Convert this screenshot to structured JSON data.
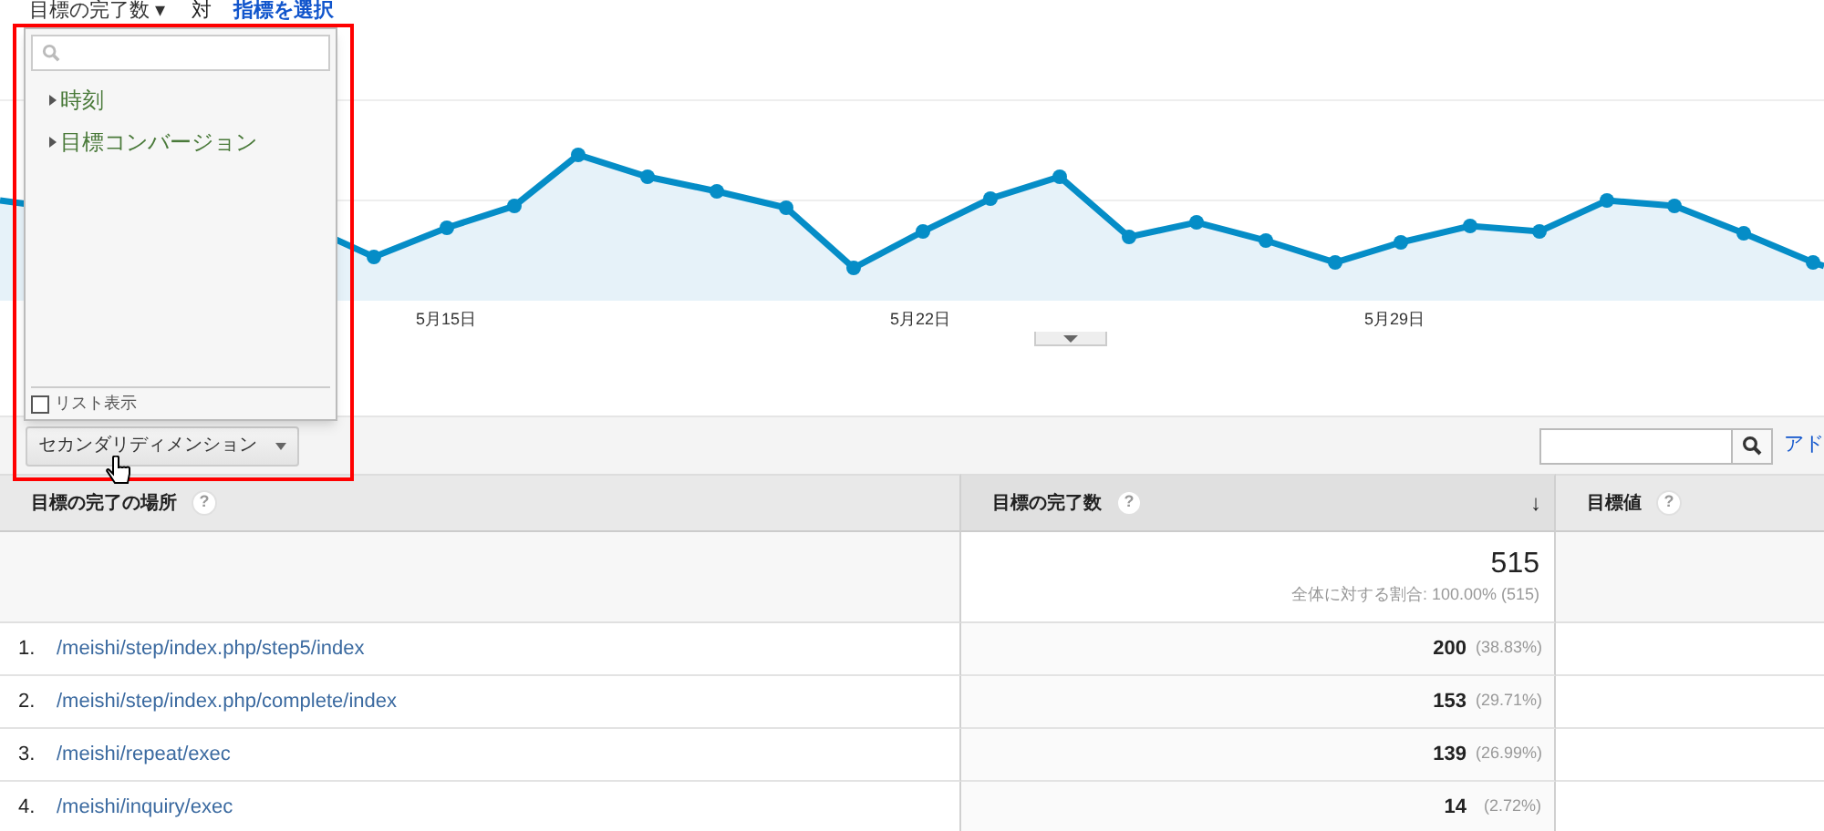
{
  "metric_selector": {
    "metric": "目標の完了数",
    "caret": "▾",
    "versus": "対",
    "select_link": "指標を選択"
  },
  "chart": {
    "x_labels": [
      "5月15日",
      "5月22日",
      "5月29日"
    ]
  },
  "dimension_menu": {
    "groups": [
      {
        "label": "時刻",
        "expanded": false
      },
      {
        "label": "目標コンバージョン",
        "expanded": false
      }
    ],
    "list_view": {
      "label": "リスト表示",
      "checked": false
    }
  },
  "toolbar": {
    "secondary_dimension": "セカンダリディメンション",
    "advanced_link": "アド"
  },
  "table": {
    "sort_arrow": "↓",
    "columns": [
      {
        "label": "目標の完了の場所",
        "help": "?",
        "sorted": false
      },
      {
        "label": "目標の完了数",
        "help": "?",
        "sorted": true
      },
      {
        "label": "目標値",
        "help": "?",
        "sorted": false
      }
    ],
    "total": {
      "value": "515",
      "share": "全体に対する割合: 100.00% (515)"
    },
    "rows": [
      {
        "index": "1.",
        "page": "/meishi/step/index.php/step5/index",
        "count": "200",
        "percent": "(38.83%)"
      },
      {
        "index": "2.",
        "page": "/meishi/step/index.php/complete/index",
        "count": "153",
        "percent": "(29.71%)"
      },
      {
        "index": "3.",
        "page": "/meishi/repeat/exec",
        "count": "139",
        "percent": "(26.99%)"
      },
      {
        "index": "4.",
        "page": "/meishi/inquiry/exec",
        "count": "14",
        "percent": "(2.72%)"
      }
    ]
  }
}
